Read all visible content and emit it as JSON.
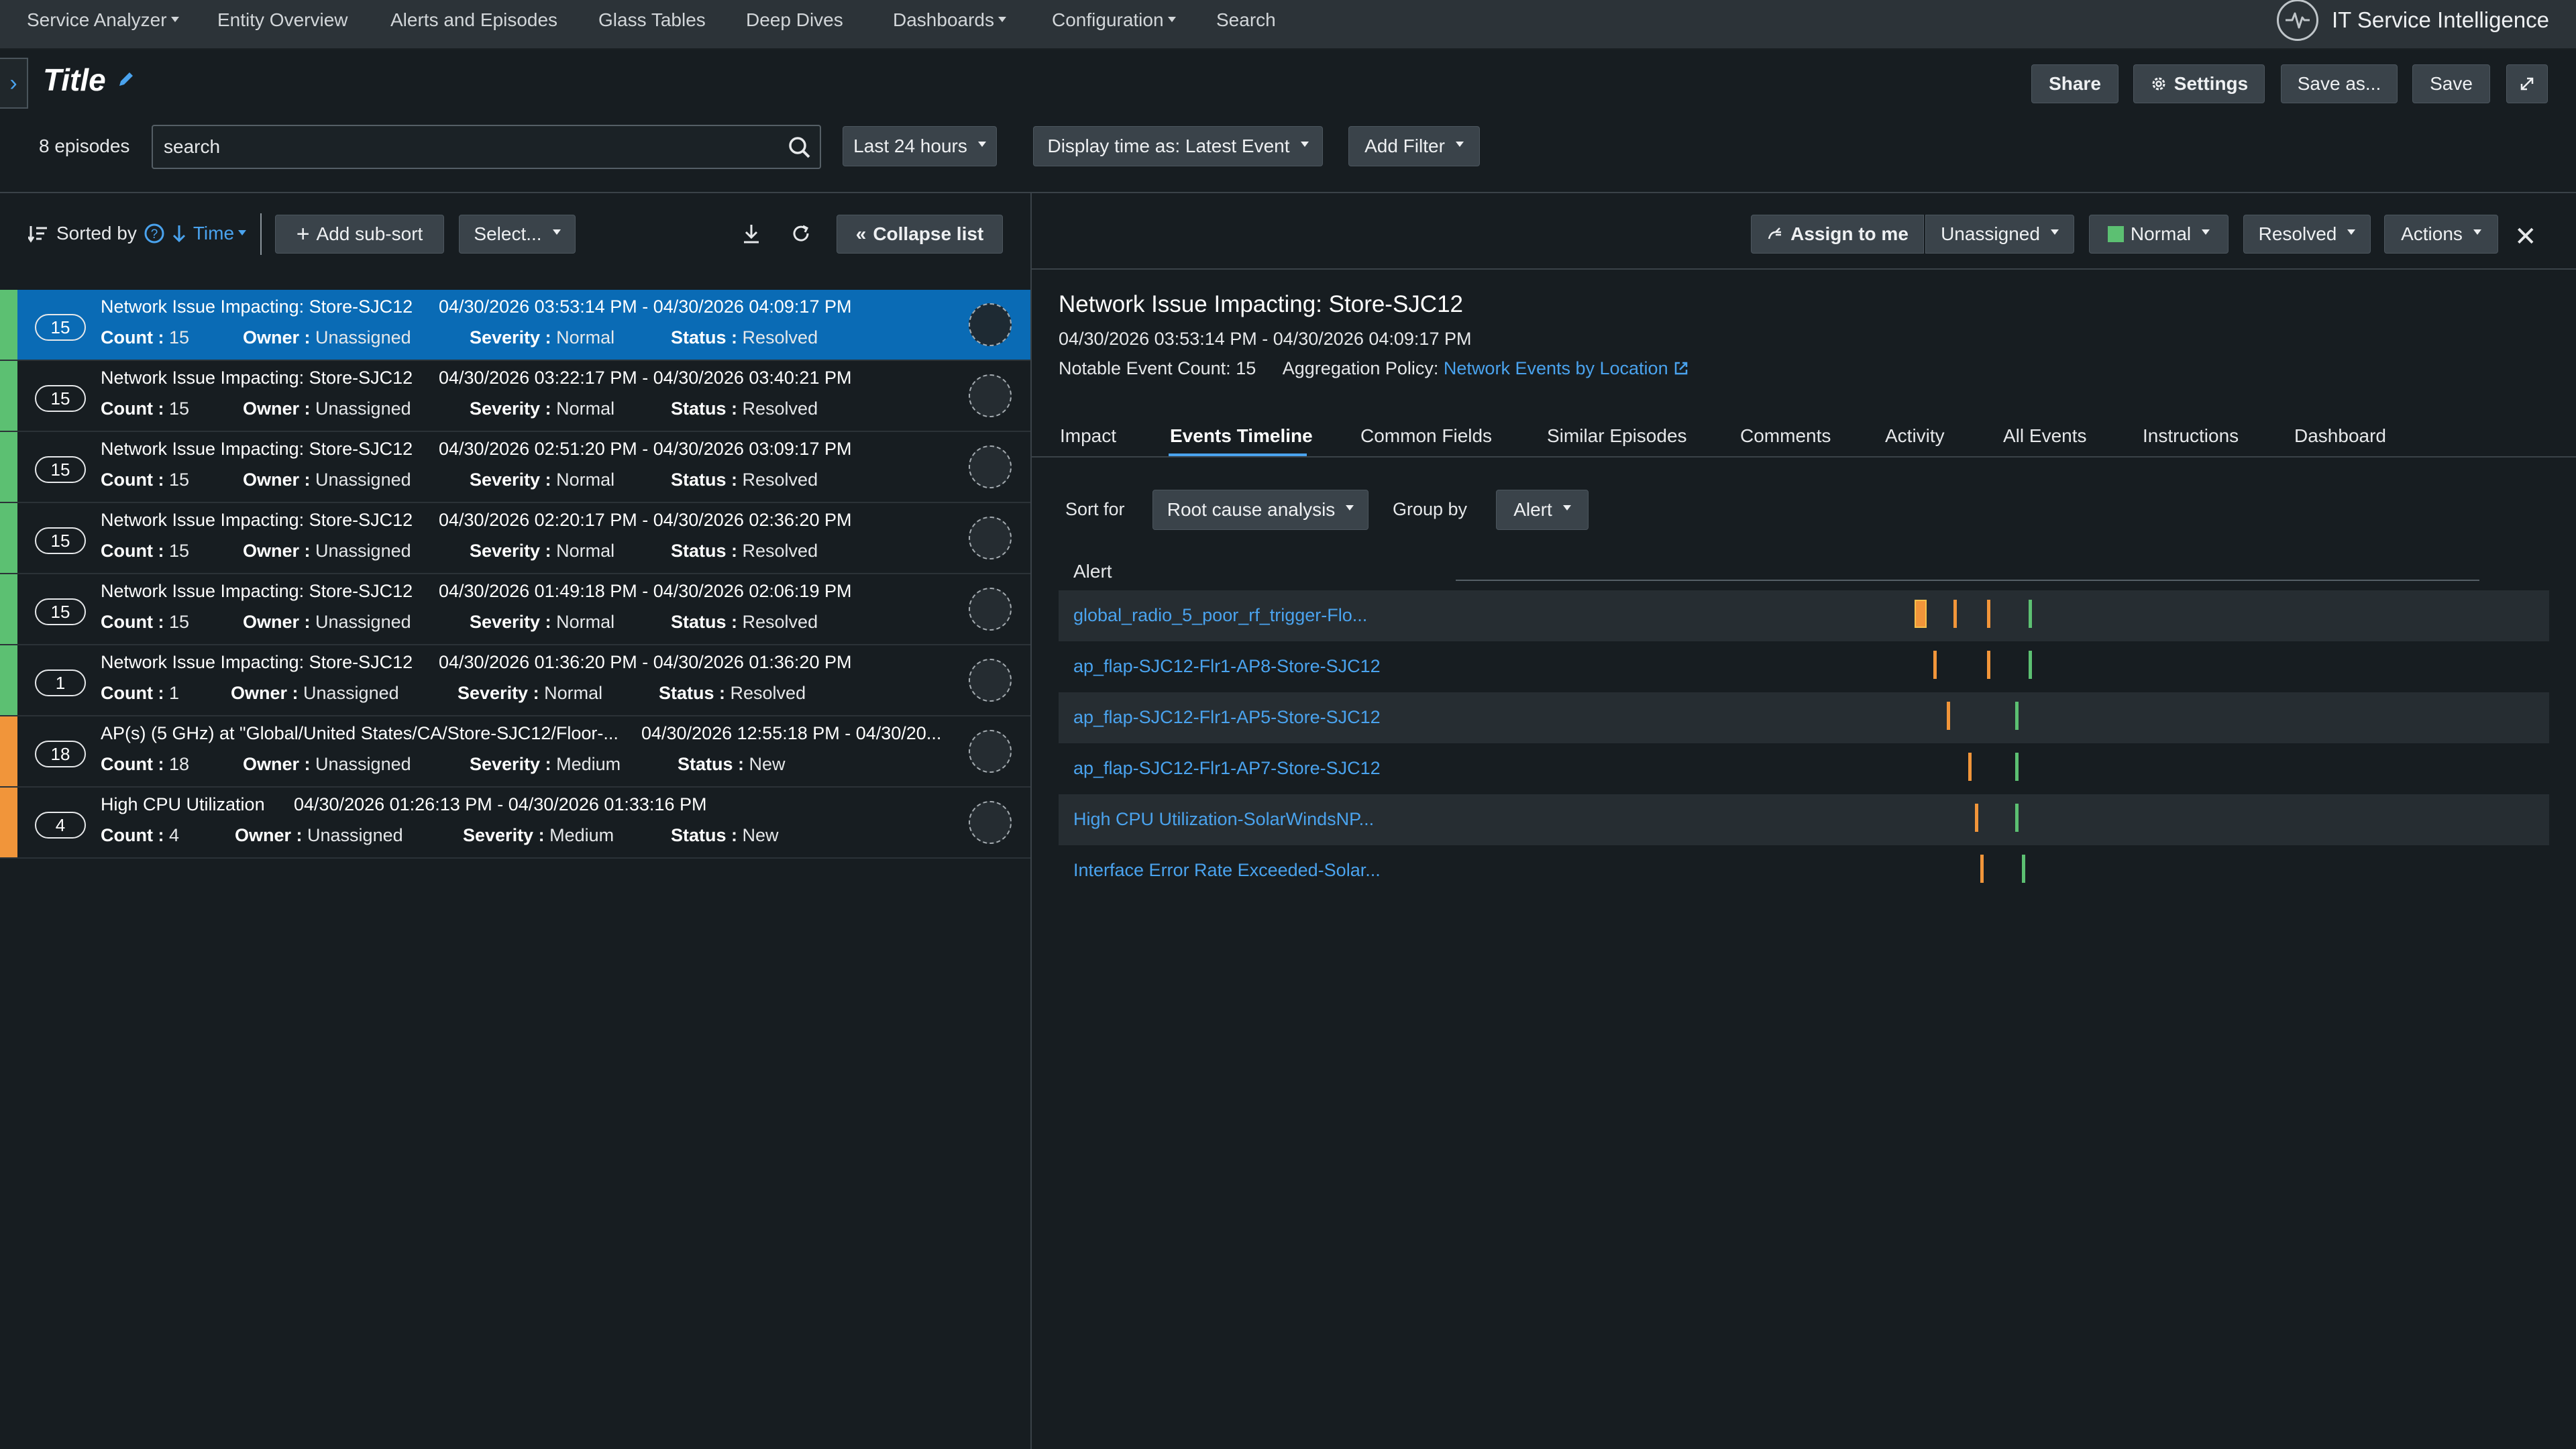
{
  "nav": {
    "items": [
      "Service Analyzer",
      "Entity Overview",
      "Alerts and Episodes",
      "Glass Tables",
      "Deep Dives",
      "Dashboards",
      "Configuration",
      "Search"
    ],
    "brand": "IT Service Intelligence"
  },
  "header": {
    "title": "Title",
    "share": "Share",
    "settings": "Settings",
    "save_as": "Save as...",
    "save": "Save"
  },
  "filters": {
    "episode_count": "8 episodes",
    "search_value": "search",
    "time_range": "Last 24 hours",
    "display_time": "Display time as: Latest Event",
    "add_filter": "Add Filter"
  },
  "list_toolbar": {
    "sorted_by": "Sorted by",
    "sort_field": "Time",
    "add_sub_sort": "Add sub-sort",
    "select": "Select...",
    "collapse": "Collapse list"
  },
  "labels": {
    "count": "Count :",
    "owner": "Owner :",
    "severity": "Severity :",
    "status": "Status :"
  },
  "episodes": [
    {
      "count": "15",
      "title": "Network Issue Impacting: Store-SJC12",
      "time": "04/30/2026 03:53:14 PM - 04/30/2026 04:09:17 PM",
      "owner": "Unassigned",
      "severity": "Normal",
      "status": "Resolved"
    },
    {
      "count": "15",
      "title": "Network Issue Impacting: Store-SJC12",
      "time": "04/30/2026 03:22:17 PM - 04/30/2026 03:40:21 PM",
      "owner": "Unassigned",
      "severity": "Normal",
      "status": "Resolved"
    },
    {
      "count": "15",
      "title": "Network Issue Impacting: Store-SJC12",
      "time": "04/30/2026 02:51:20 PM - 04/30/2026 03:09:17 PM",
      "owner": "Unassigned",
      "severity": "Normal",
      "status": "Resolved"
    },
    {
      "count": "15",
      "title": "Network Issue Impacting: Store-SJC12",
      "time": "04/30/2026 02:20:17 PM - 04/30/2026 02:36:20 PM",
      "owner": "Unassigned",
      "severity": "Normal",
      "status": "Resolved"
    },
    {
      "count": "15",
      "title": "Network Issue Impacting: Store-SJC12",
      "time": "04/30/2026 01:49:18 PM - 04/30/2026 02:06:19 PM",
      "owner": "Unassigned",
      "severity": "Normal",
      "status": "Resolved"
    },
    {
      "count": "1",
      "title": "Network Issue Impacting: Store-SJC12",
      "time": "04/30/2026 01:36:20 PM - 04/30/2026 01:36:20 PM",
      "owner": "Unassigned",
      "severity": "Normal",
      "status": "Resolved"
    },
    {
      "count": "18",
      "title": "AP(s) (5 GHz) at \"Global/United States/CA/Store-SJC12/Floor-...",
      "time": "04/30/2026 12:55:18 PM - 04/30/20...",
      "owner": "Unassigned",
      "severity": "Medium",
      "status": "New"
    },
    {
      "count": "4",
      "title": "High CPU Utilization",
      "time": "04/30/2026 01:26:13 PM - 04/30/2026 01:33:16 PM",
      "owner": "Unassigned",
      "severity": "Medium",
      "status": "New"
    }
  ],
  "detail": {
    "assign_to_me": "Assign to me",
    "owner": "Unassigned",
    "severity": "Normal",
    "status": "Resolved",
    "actions": "Actions",
    "title": "Network Issue Impacting: Store-SJC12",
    "time": "04/30/2026 03:53:14 PM - 04/30/2026 04:09:17 PM",
    "notable_label": "Notable Event Count:",
    "notable_count": "15",
    "policy_label": "Aggregation Policy:",
    "policy_link": "Network Events by Location",
    "tabs": [
      "Impact",
      "Events Timeline",
      "Common Fields",
      "Similar Episodes",
      "Comments",
      "Activity",
      "All Events",
      "Instructions",
      "Dashboard"
    ],
    "sort_for_label": "Sort for",
    "sort_for_value": "Root cause analysis",
    "group_by_label": "Group by",
    "group_by_value": "Alert",
    "alert_column": "Alert",
    "alerts": [
      "global_radio_5_poor_rf_trigger-Flo...",
      "ap_flap-SJC12-Flr1-AP8-Store-SJC12",
      "ap_flap-SJC12-Flr1-AP5-Store-SJC12",
      "ap_flap-SJC12-Flr1-AP7-Store-SJC12",
      "High CPU Utilization-SolarWindsNP...",
      "Interface Error Rate Exceeded-Solar..."
    ]
  },
  "colors": {
    "accent": "#4aa3ee",
    "selected_row": "#0a6bb5",
    "severity_normal": "#5cc072",
    "severity_medium": "#f1953a"
  }
}
